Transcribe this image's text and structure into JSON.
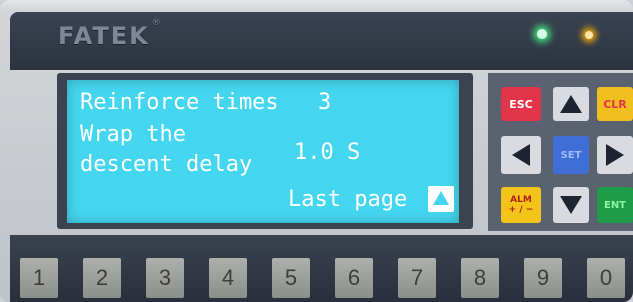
{
  "brand": {
    "name": "FATEK",
    "mark": "®"
  },
  "screen": {
    "line1_label": "Reinforce times",
    "line1_value": "3",
    "line2_label_a": "Wrap the",
    "line2_label_b": "descent delay",
    "line2_value": "1.0 S",
    "line3_text": "Last page"
  },
  "keys": {
    "esc": "ESC",
    "clr": "CLR",
    "set": "SET",
    "alm_top": "ALM",
    "alm_bottom": "+ / −",
    "ent": "ENT"
  },
  "number_keys": [
    "1",
    "2",
    "3",
    "4",
    "5",
    "6",
    "7",
    "8",
    "9",
    "0"
  ],
  "colors": {
    "lcd_background": "#45d6ef",
    "lcd_text": "#ffffff",
    "esc_key": "#e2344a",
    "clr_key": "#f0bf1e",
    "set_key": "#3f6fd6",
    "alm_key": "#f2c41a",
    "ent_key": "#1e9c48",
    "led_green": "#46ff8a",
    "led_orange": "#ffb100"
  },
  "icons": [
    "up-arrow-icon",
    "down-arrow-icon",
    "left-arrow-icon",
    "right-arrow-icon",
    "page-up-icon"
  ]
}
